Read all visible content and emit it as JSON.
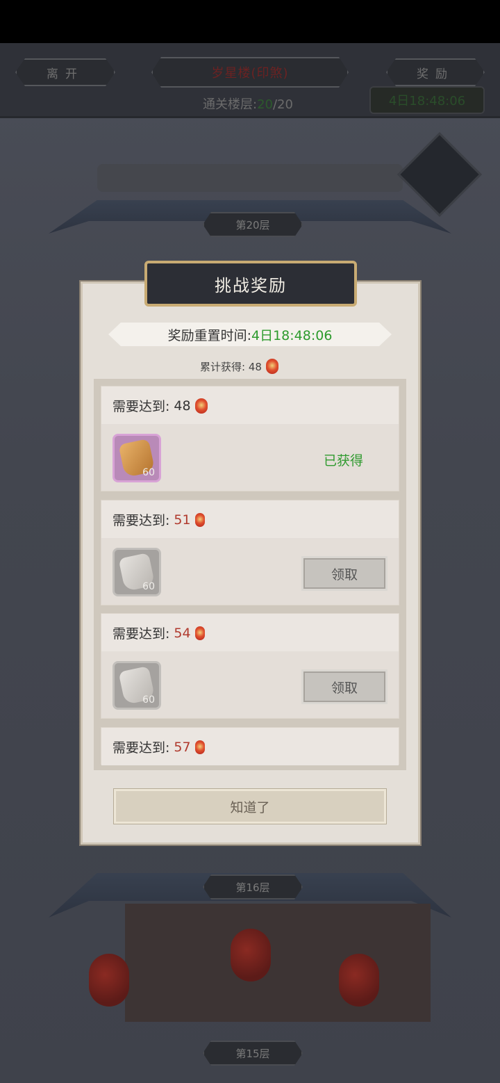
{
  "topbar": {
    "leave_label": "离开",
    "tower_title": "岁星楼(印煞)",
    "reward_label": "奖励",
    "floors_cleared_label": "通关楼层:",
    "floors_cleared_current": "20",
    "floors_cleared_total": "/20",
    "reset_timer": "4日18:48:06"
  },
  "tower": {
    "floor_top": "第20层",
    "floor_mid": "第16层",
    "floor_bottom": "第15层"
  },
  "modal": {
    "title": "挑战奖励",
    "reset_label": "奖励重置时间:",
    "reset_time": "4日18:48:06",
    "total_label": "累计获得: 48",
    "tiers": [
      {
        "label": "需要达到:",
        "target": "48",
        "item_qty": "60",
        "status": "已获得"
      },
      {
        "label": "需要达到:",
        "target": "51",
        "item_qty": "60",
        "button": "领取"
      },
      {
        "label": "需要达到:",
        "target": "54",
        "item_qty": "60",
        "button": "领取"
      },
      {
        "label": "需要达到:",
        "target": "57"
      }
    ],
    "confirm_label": "知道了"
  },
  "colors": {
    "claimed_green": "#2f9a2f",
    "target_red": "#b03a2e",
    "header_gold": "#c8ab73"
  }
}
